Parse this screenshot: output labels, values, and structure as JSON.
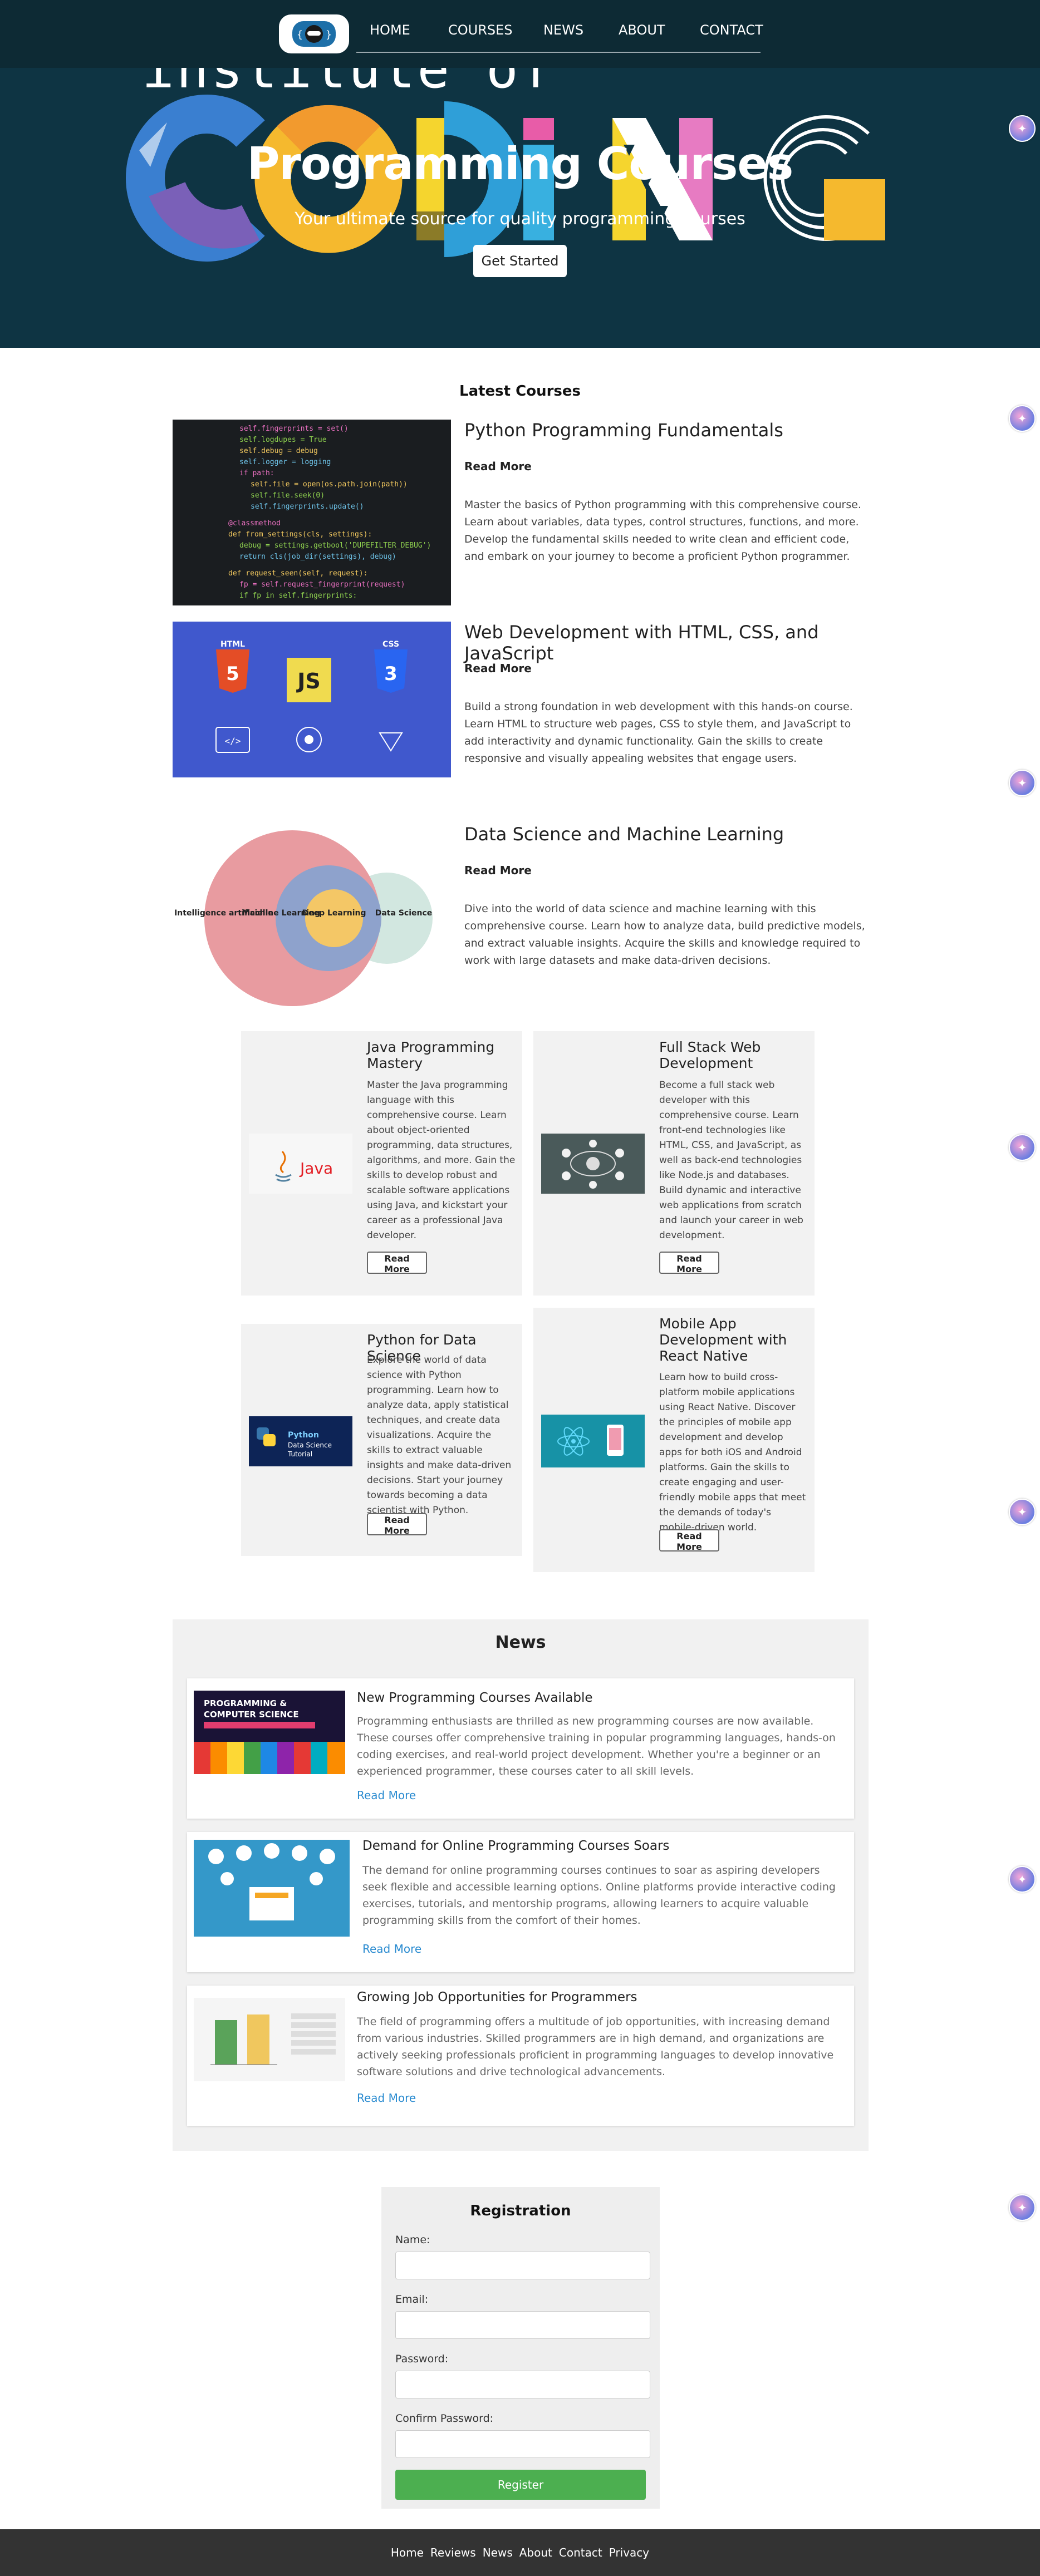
{
  "nav": {
    "links": [
      "HOME",
      "COURSES",
      "NEWS",
      "ABOUT",
      "CONTACT"
    ]
  },
  "hero": {
    "art_text_top": "institute of",
    "art_text_big": "CODING",
    "title": "Programming Courses",
    "subtitle": "Your ultimate source for quality programming courses",
    "cta_label": "Get Started"
  },
  "latest": {
    "heading": "Latest Courses",
    "courses": [
      {
        "title": "Python Programming Fundamentals",
        "read_more": "Read More",
        "description": "Master the basics of Python programming with this comprehensive course. Learn about variables, data types, control structures, functions, and more. Develop the fundamental skills needed to write clean and efficient code, and embark on your journey to become a proficient Python programmer."
      },
      {
        "title": "Web Development with HTML, CSS, and JavaScript",
        "read_more": "Read More",
        "description": "Build a strong foundation in web development with this hands-on course. Learn HTML to structure web pages, CSS to style them, and JavaScript to add interactivity and dynamic functionality. Gain the skills to create responsive and visually appealing websites that engage users."
      },
      {
        "title": "Data Science and Machine Learning",
        "read_more": "Read More",
        "description": "Dive into the world of data science and machine learning with this comprehensive course. Learn how to analyze data, build predictive models, and extract valuable insights. Acquire the skills and knowledge required to work with large datasets and make data-driven decisions."
      }
    ],
    "html_badges": [
      "HTML",
      "JS",
      "CSS"
    ],
    "venn_labels": [
      "Intelligence artificielle",
      "Machine Learning",
      "Deep Learning",
      "Data Science"
    ]
  },
  "cards": [
    {
      "title": "Java Programming Mastery",
      "description": "Master the Java programming language with this comprehensive course. Learn about object-oriented programming, data structures, algorithms, and more. Gain the skills to develop robust and scalable software applications using Java, and kickstart your career as a professional Java developer.",
      "button": "Read More",
      "img_label": "Java"
    },
    {
      "title": "Full Stack Web Development",
      "description": "Become a full stack web developer with this comprehensive course. Learn front-end technologies like HTML, CSS, and JavaScript, as well as back-end technologies like Node.js and databases. Build dynamic and interactive web applications from scratch and launch your career in web development.",
      "button": "Read More"
    },
    {
      "title": "Python for Data Science",
      "description": "Explore the world of data science with Python programming. Learn how to analyze data, apply statistical techniques, and create data visualizations. Acquire the skills to extract valuable insights and make data-driven decisions. Start your journey towards becoming a data scientist with Python.",
      "button": "Read More",
      "img_label": "Python Data Science Tutorial"
    },
    {
      "title": "Mobile App Development with React Native",
      "description": "Learn how to build cross-platform mobile applications using React Native. Discover the principles of mobile app development and develop apps for both iOS and Android platforms. Gain the skills to create engaging and user-friendly mobile apps that meet the demands of today's mobile-driven world.",
      "button": "Read More"
    }
  ],
  "news": {
    "heading": "News",
    "items": [
      {
        "title": "New Programming Courses Available",
        "description": "Programming enthusiasts are thrilled as new programming courses are now available. These courses offer comprehensive training in popular programming languages, hands-on coding exercises, and real-world project development. Whether you're a beginner or an experienced programmer, these courses cater to all skill levels.",
        "link": "Read More",
        "img_title": "PROGRAMMING & COMPUTER SCIENCE"
      },
      {
        "title": "Demand for Online Programming Courses Soars",
        "description": "The demand for online programming courses continues to soar as aspiring developers seek flexible and accessible learning options. Online platforms provide interactive coding exercises, tutorials, and mentorship programs, allowing learners to acquire valuable programming skills from the comfort of their homes.",
        "link": "Read More"
      },
      {
        "title": "Growing Job Opportunities for Programmers",
        "description": "The field of programming offers a multitude of job opportunities, with increasing demand from various industries. Skilled programmers are in high demand, and organizations are actively seeking professionals proficient in programming languages to develop innovative software solutions and drive technological advancements.",
        "link": "Read More"
      }
    ]
  },
  "registration": {
    "title": "Registration",
    "fields": [
      "Name:",
      "Email:",
      "Password:",
      "Confirm Password:"
    ],
    "submit": "Register"
  },
  "footer": {
    "links": [
      "Home",
      "Reviews",
      "News",
      "About",
      "Contact",
      "Privacy"
    ]
  },
  "colors": {
    "hero_bg": "#0e3443",
    "nav_bg": "#0d2a34",
    "register_green": "#4caf50",
    "link_blue": "#2a8bd0",
    "footer_bg": "#333333"
  }
}
